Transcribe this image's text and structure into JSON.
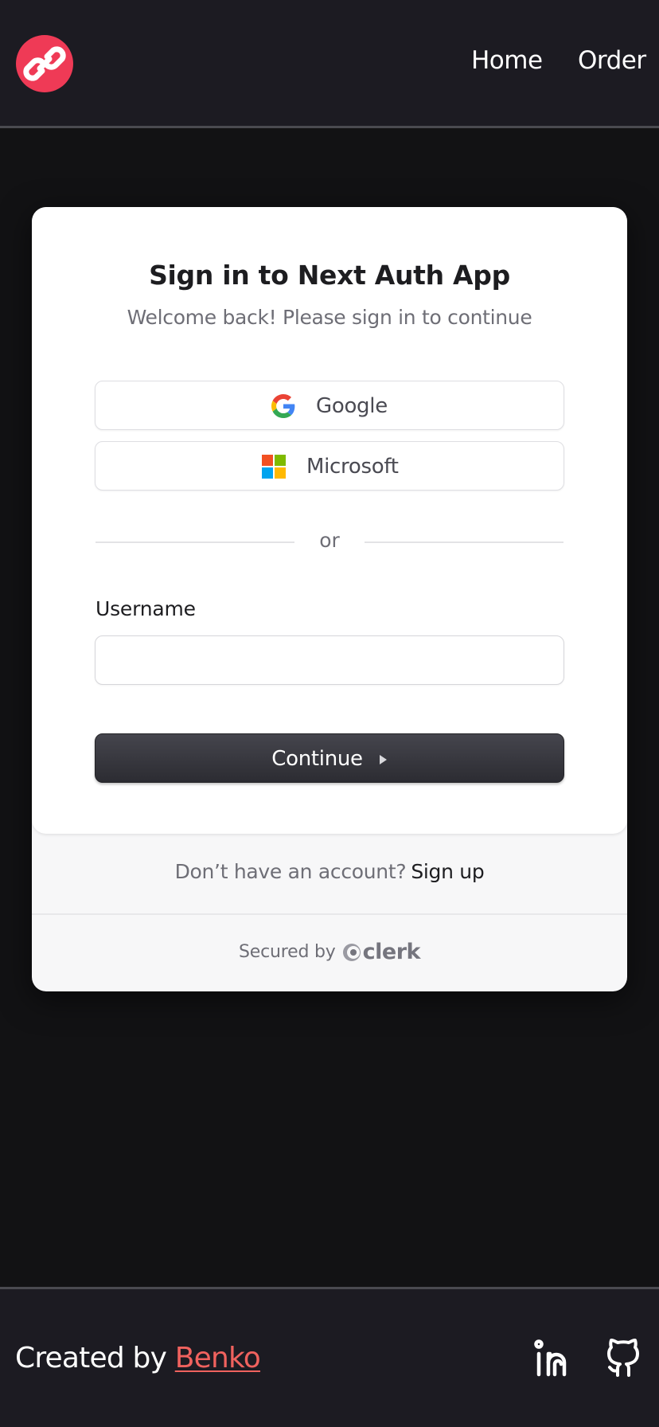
{
  "header": {
    "logo_icon": "link-icon",
    "nav": [
      {
        "label": "Home"
      },
      {
        "label": "Order"
      }
    ]
  },
  "sign_in": {
    "title": "Sign in to Next Auth App",
    "subtitle": "Welcome back! Please sign in to continue",
    "social": {
      "google": {
        "label": "Google",
        "icon": "google-icon"
      },
      "microsoft": {
        "label": "Microsoft",
        "icon": "microsoft-icon"
      }
    },
    "divider": "or",
    "username": {
      "label": "Username",
      "value": "",
      "placeholder": ""
    },
    "continue_label": "Continue",
    "signup": {
      "prompt": "Don’t have an account?",
      "link": "Sign up"
    },
    "secured_by": "Secured by",
    "clerk": "clerk"
  },
  "footer": {
    "credit_prefix": "Created by",
    "credit_name": "Benko",
    "icons": [
      "linkedin-icon",
      "github-icon"
    ]
  },
  "colors": {
    "header_bg": "#1c1b22",
    "page_bg": "#121214",
    "brand": "#ef3a56",
    "link": "#f0625e",
    "button_dark": "#35353b"
  }
}
